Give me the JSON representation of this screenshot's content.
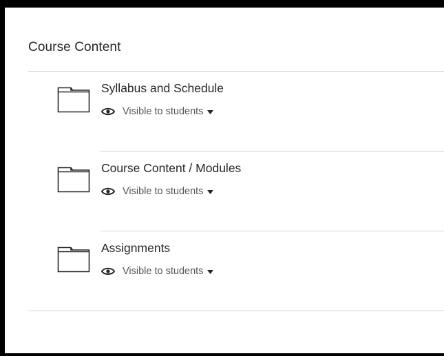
{
  "content": {
    "title": "Course Content",
    "items": [
      {
        "title": "Syllabus and Schedule",
        "visibility": "Visible to students",
        "icon": "folder-icon"
      },
      {
        "title": "Course Content / Modules",
        "visibility": "Visible to students",
        "icon": "folder-icon"
      },
      {
        "title": "Assignments",
        "visibility": "Visible to students",
        "icon": "folder-icon"
      }
    ]
  }
}
